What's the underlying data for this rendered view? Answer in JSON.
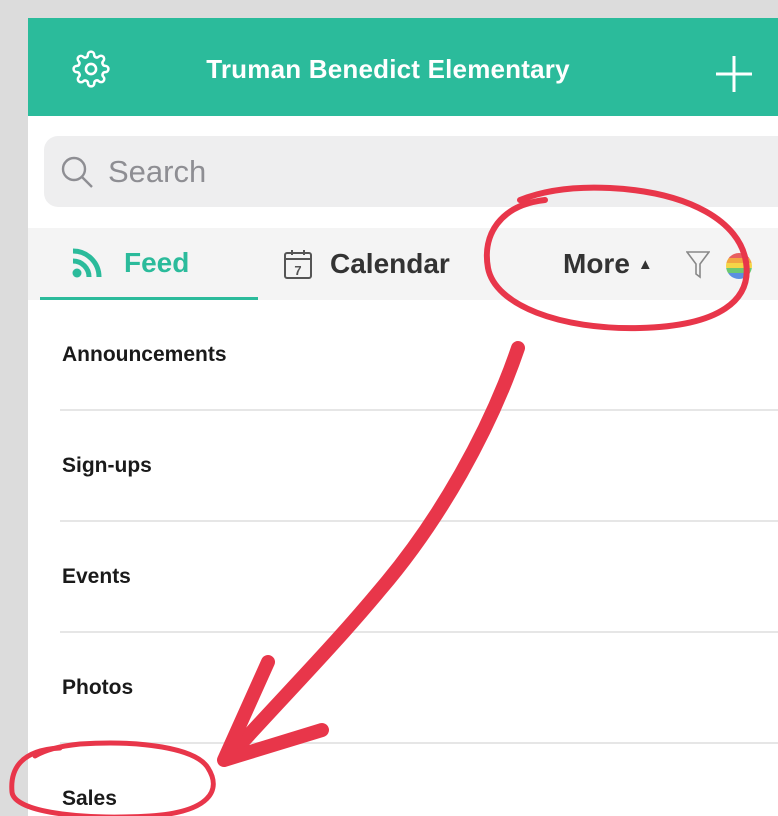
{
  "header": {
    "title": "Truman Benedict Elementary",
    "settings_icon": "gear-icon",
    "add_icon": "plus-icon",
    "color": "#2bbb9b"
  },
  "search": {
    "placeholder": "Search"
  },
  "tabs": [
    {
      "label": "Feed",
      "icon": "rss-icon",
      "active": true
    },
    {
      "label": "Calendar",
      "icon": "calendar-icon",
      "day": "7"
    },
    {
      "label": "More",
      "icon": "triangle-up-icon"
    }
  ],
  "toolbar": {
    "filter_icon": "filter-icon",
    "avatar_icon": "rainbow-avatar"
  },
  "list": {
    "items": [
      {
        "label": "Announcements"
      },
      {
        "label": "Sign-ups"
      },
      {
        "label": "Events"
      },
      {
        "label": "Photos"
      },
      {
        "label": "Sales"
      }
    ]
  },
  "annotations": {
    "color": "#e8364a"
  }
}
